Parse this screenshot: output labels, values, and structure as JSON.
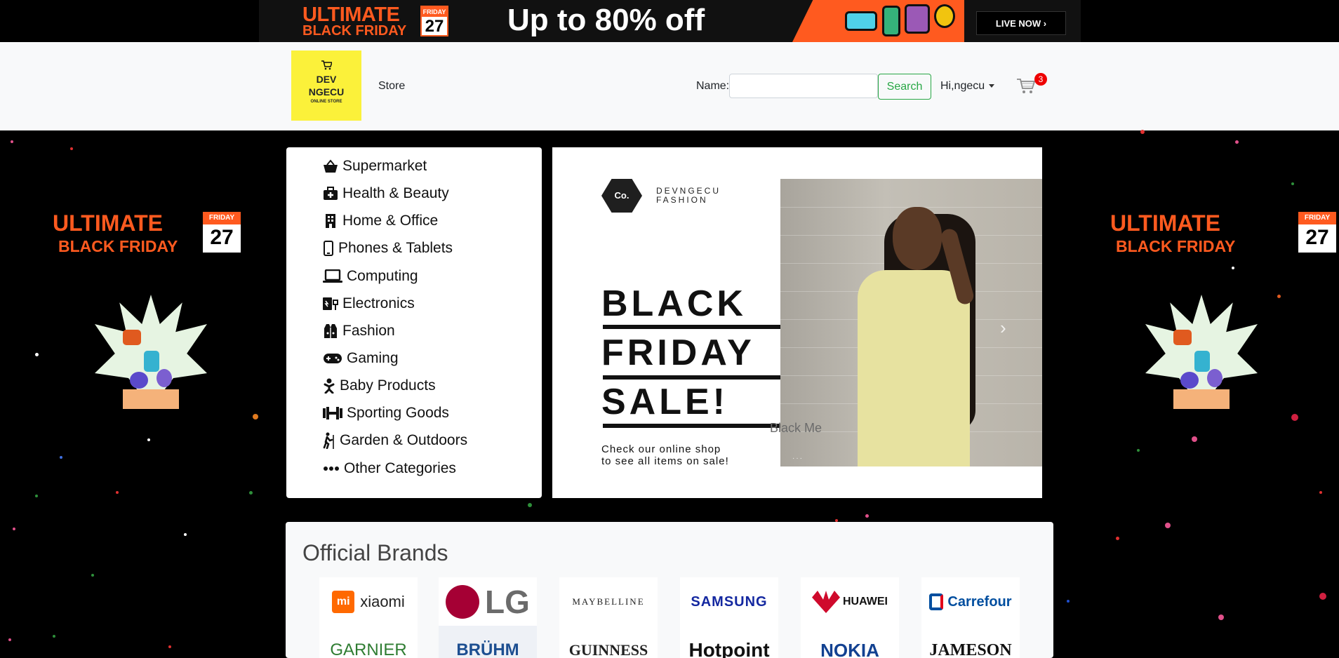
{
  "banner": {
    "ultimate": "ULTIMATE",
    "black_friday": "BLACK FRIDAY",
    "cal_day": "FRIDAY",
    "cal_date": "27",
    "deal": "Up to 80% off",
    "live_button": "LIVE NOW ›"
  },
  "navbar": {
    "logo_line1": "DEV",
    "logo_line2": "NGECU",
    "logo_line3": "ONLINE STORE",
    "store_link": "Store",
    "name_label": "Name:",
    "search_value": "",
    "search_button": "Search",
    "user_greeting": "Hi,ngecu",
    "cart_count": "3"
  },
  "side_promo": {
    "ultimate": "ULTIMATE",
    "black_friday": "BLACK FRIDAY",
    "cal_day": "FRIDAY",
    "cal_date": "27"
  },
  "categories": [
    {
      "label": "Supermarket",
      "icon": "basket-icon"
    },
    {
      "label": "Health & Beauty",
      "icon": "medkit-icon"
    },
    {
      "label": "Home & Office",
      "icon": "building-icon"
    },
    {
      "label": "Phones & Tablets",
      "icon": "phone-icon"
    },
    {
      "label": "Computing",
      "icon": "laptop-icon"
    },
    {
      "label": "Electronics",
      "icon": "plug-icon"
    },
    {
      "label": "Fashion",
      "icon": "vest-icon"
    },
    {
      "label": "Gaming",
      "icon": "gamepad-icon"
    },
    {
      "label": "Baby Products",
      "icon": "baby-icon"
    },
    {
      "label": "Sporting Goods",
      "icon": "dumbbell-icon"
    },
    {
      "label": "Garden & Outdoors",
      "icon": "hiking-icon"
    },
    {
      "label": "Other Categories",
      "icon": "ellipsis-icon"
    }
  ],
  "carousel": {
    "co_logo": "Co.",
    "brand_line1": "DEVNGECU",
    "brand_line2": "FASHION",
    "headline": [
      "BLACK",
      "FRIDAY",
      "SALE!"
    ],
    "promo_line1": "Check our online shop",
    "promo_line2": "to see all items on sale!",
    "caption": "Black Me",
    "next_arrow": "›",
    "indicators": "···"
  },
  "brands": {
    "title": "Official Brands",
    "row1": [
      "xiaomi",
      "LG",
      "MAYBELLINE",
      "SAMSUNG",
      "HUAWEI",
      "Carrefour"
    ],
    "row2": [
      "GARNIER",
      "BRÜHM",
      "GUINNESS",
      "Hotpoint",
      "NOKIA",
      "JAMESON"
    ],
    "colors": {
      "xiaomi": "#ff6900",
      "LG": "#a50034",
      "SAMSUNG": "#1428a0",
      "HUAWEI": "#cf0a2c",
      "Carrefour": "#004e9f",
      "GARNIER": "#2f7d32",
      "BRÜHM": "#1d4f91",
      "Hotpoint": "#111111",
      "NOKIA": "#124191",
      "JAMESON": "#111111"
    }
  }
}
